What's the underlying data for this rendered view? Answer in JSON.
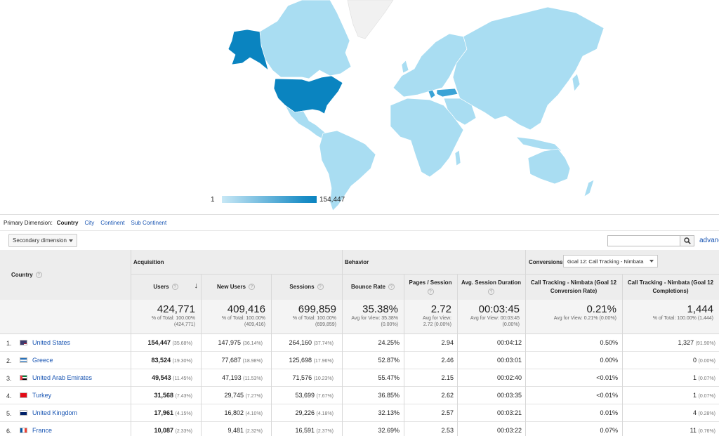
{
  "map": {
    "legend_min": "1",
    "legend_max": "154,447",
    "colors": {
      "high": "#0a84c0",
      "mid": "#3ba3d6",
      "low": "#a9ddf2",
      "none": "#f1f1f1"
    }
  },
  "primary_dimension": {
    "label": "Primary Dimension:",
    "active": "Country",
    "options": [
      "City",
      "Continent",
      "Sub Continent"
    ]
  },
  "secondary_dimension": "Secondary dimension",
  "search": {
    "advanced": "advanced"
  },
  "table": {
    "country_header": "Country",
    "groups": {
      "acquisition": "Acquisition",
      "behavior": "Behavior",
      "conversions": "Conversions"
    },
    "goal_select": "Goal 12: Call Tracking - Nimbata",
    "columns": {
      "users": "Users",
      "new_users": "New Users",
      "sessions": "Sessions",
      "bounce_rate": "Bounce Rate",
      "pages_session": "Pages / Session",
      "avg_duration": "Avg. Session Duration",
      "conv_rate": "Call Tracking - Nimbata (Goal 12 Conversion Rate)",
      "completions": "Call Tracking - Nimbata (Goal 12 Completions)"
    },
    "totals": {
      "users": "424,771",
      "users_sub1": "% of Total: 100.00%",
      "users_sub2": "(424,771)",
      "new_users": "409,416",
      "new_users_sub1": "% of Total: 100.00%",
      "new_users_sub2": "(409,416)",
      "sessions": "699,859",
      "sessions_sub1": "% of Total: 100.00%",
      "sessions_sub2": "(699,859)",
      "bounce_rate": "35.38%",
      "bounce_sub1": "Avg for View: 35.38%",
      "bounce_sub2": "(0.00%)",
      "pages_session": "2.72",
      "pages_sub1": "Avg for View:",
      "pages_sub2": "2.72 (0.00%)",
      "avg_duration": "00:03:45",
      "dur_sub1": "Avg for View: 00:03:45",
      "dur_sub2": "(0.00%)",
      "conv_rate": "0.21%",
      "conv_sub1": "Avg for View: 0.21% (0.00%)",
      "completions": "1,444",
      "comp_sub1": "% of Total: 100.00% (1,444)"
    },
    "rows": [
      {
        "num": "1.",
        "country": "United States",
        "flag": "us-flag",
        "users": "154,447",
        "users_pct": "(35.68%)",
        "new_users": "147,975",
        "new_users_pct": "(36.14%)",
        "sessions": "264,160",
        "sessions_pct": "(37.74%)",
        "bounce": "24.25%",
        "pages": "2.94",
        "duration": "00:04:12",
        "conv": "0.50%",
        "comp": "1,327",
        "comp_pct": "(91.90%)"
      },
      {
        "num": "2.",
        "country": "Greece",
        "flag": "gr-flag",
        "users": "83,524",
        "users_pct": "(19.30%)",
        "new_users": "77,687",
        "new_users_pct": "(18.98%)",
        "sessions": "125,698",
        "sessions_pct": "(17.96%)",
        "bounce": "52.87%",
        "pages": "2.46",
        "duration": "00:03:01",
        "conv": "0.00%",
        "comp": "0",
        "comp_pct": "(0.00%)"
      },
      {
        "num": "3.",
        "country": "United Arab Emirates",
        "flag": "ae-flag",
        "users": "49,543",
        "users_pct": "(11.45%)",
        "new_users": "47,193",
        "new_users_pct": "(11.53%)",
        "sessions": "71,576",
        "sessions_pct": "(10.23%)",
        "bounce": "55.47%",
        "pages": "2.15",
        "duration": "00:02:40",
        "conv": "<0.01%",
        "comp": "1",
        "comp_pct": "(0.07%)"
      },
      {
        "num": "4.",
        "country": "Turkey",
        "flag": "tr-flag",
        "users": "31,568",
        "users_pct": "(7.43%)",
        "new_users": "29,745",
        "new_users_pct": "(7.27%)",
        "sessions": "53,699",
        "sessions_pct": "(7.67%)",
        "bounce": "36.85%",
        "pages": "2.62",
        "duration": "00:03:35",
        "conv": "<0.01%",
        "comp": "1",
        "comp_pct": "(0.07%)"
      },
      {
        "num": "5.",
        "country": "United Kingdom",
        "flag": "gb-flag",
        "users": "17,961",
        "users_pct": "(4.15%)",
        "new_users": "16,802",
        "new_users_pct": "(4.10%)",
        "sessions": "29,226",
        "sessions_pct": "(4.18%)",
        "bounce": "32.13%",
        "pages": "2.57",
        "duration": "00:03:21",
        "conv": "0.01%",
        "comp": "4",
        "comp_pct": "(0.28%)"
      },
      {
        "num": "6.",
        "country": "France",
        "flag": "fr-flag",
        "users": "10,087",
        "users_pct": "(2.33%)",
        "new_users": "9,481",
        "new_users_pct": "(2.32%)",
        "sessions": "16,591",
        "sessions_pct": "(2.37%)",
        "bounce": "32.69%",
        "pages": "2.53",
        "duration": "00:03:22",
        "conv": "0.07%",
        "comp": "11",
        "comp_pct": "(0.76%)"
      }
    ]
  }
}
